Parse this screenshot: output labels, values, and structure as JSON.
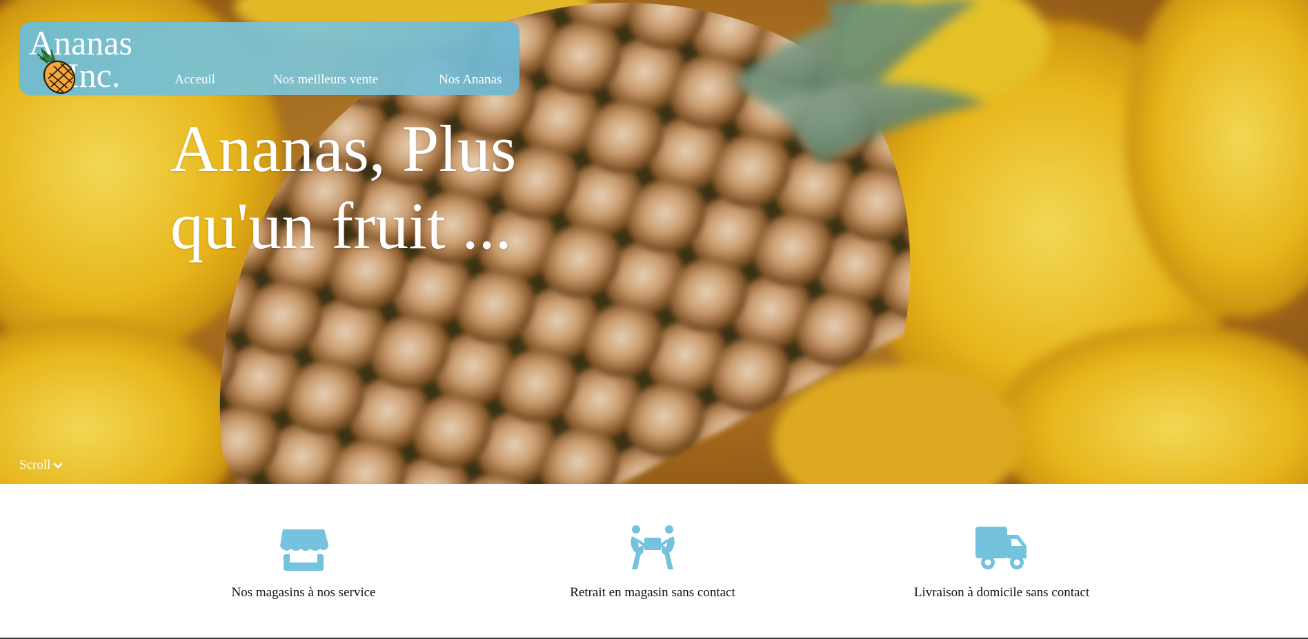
{
  "brand": {
    "line1": "Ananas",
    "line2": "Inc.",
    "logo_icon": "pineapple-icon"
  },
  "nav": {
    "items": [
      {
        "label": "Acceuil"
      },
      {
        "label": "Nos meilleurs vente"
      },
      {
        "label": "Nos Ananas"
      }
    ]
  },
  "hero": {
    "headline_line1": "Ananas, Plus",
    "headline_line2": "qu'un fruit ...",
    "scroll_label": "Scroll",
    "scroll_icon": "chevron-down-icon"
  },
  "features": [
    {
      "icon": "store-icon",
      "label": "Nos magasins à nos service"
    },
    {
      "icon": "people-carry-box-icon",
      "label": "Retrait en magasin sans contact"
    },
    {
      "icon": "truck-icon",
      "label": "Livraison à domicile sans contact"
    }
  ],
  "colors": {
    "accent": "#75c2df",
    "navbar": "#6fbcd4",
    "text_dark": "#111111"
  }
}
